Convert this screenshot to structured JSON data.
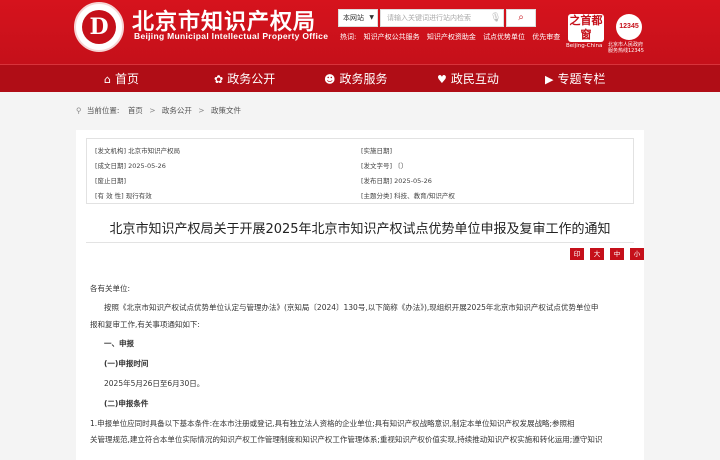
{
  "header": {
    "logo_glyph": "D",
    "title": "北京市知识产权局",
    "subtitle": "Beijing Municipal Intellectual Property Office",
    "search": {
      "scope": "本网站",
      "placeholder": "请输入关键词进行站内检索"
    },
    "hotwords_label": "热词:",
    "hotwords": [
      "知识产权公共服务",
      "知识产权资助金",
      "试点优势单位",
      "优先审查"
    ],
    "badge_capital": "之首都窗",
    "badge_capital_label": "Beijing-China",
    "badge_12345": "12345",
    "badge_12345_label": "北京市人民政府\n服务热线12345"
  },
  "nav": {
    "items": [
      {
        "label": "首页",
        "icon": "home-icon"
      },
      {
        "label": "政务公开",
        "icon": "gear-icon"
      },
      {
        "label": "政务服务",
        "icon": "people-icon"
      },
      {
        "label": "政民互动",
        "icon": "heart-icon"
      },
      {
        "label": "专题专栏",
        "icon": "play-icon"
      }
    ]
  },
  "breadcrumb": {
    "prefix": "当前位置:",
    "items": [
      "首页",
      "政务公开",
      "政策文件"
    ]
  },
  "meta": {
    "issuer": "[发文机构] 北京市知识产权局",
    "created": "[成文日期] 2025-05-26",
    "expired": "[废止日期]",
    "validity": "[有  效  性] 现行有效",
    "implement": "[实施日期]",
    "doc_no": "[发文字号] 〔〕",
    "published": "[发布日期] 2025-05-26",
    "topic": "[主题分类] 科技、教育/知识产权"
  },
  "document": {
    "title": "北京市知识产权局关于开展2025年北京市知识产权试点优势单位申报及复审工作的通知",
    "tools": {
      "print": "印",
      "large": "大",
      "medium": "中",
      "small": "小"
    },
    "salutation": "各有关单位:",
    "para1_line1": "按照《北京市知识产权试点优势单位认定与管理办法》(京知局〔2024〕130号,以下简称《办法》),现组织开展2025年北京市知识产权试点优势单位申",
    "para1_line2": "报和复审工作,有关事项通知如下:",
    "section1": "一、申报",
    "sub1": "(一)申报时间",
    "sub1_text": "2025年5月26日至6月30日。",
    "sub2": "(二)申报条件",
    "cond_line1": "1.申报单位应同时具备以下基本条件:在本市注册或登记,具有独立法人资格的企业单位;具有知识产权战略意识,制定本单位知识产权发展战略;参照相",
    "cond_line2": "关管理规范,建立符合本单位实际情况的知识产权工作管理制度和知识产权工作管理体系;重视知识产权价值实现,持续推动知识产权实施和转化运用;遵守知识"
  }
}
